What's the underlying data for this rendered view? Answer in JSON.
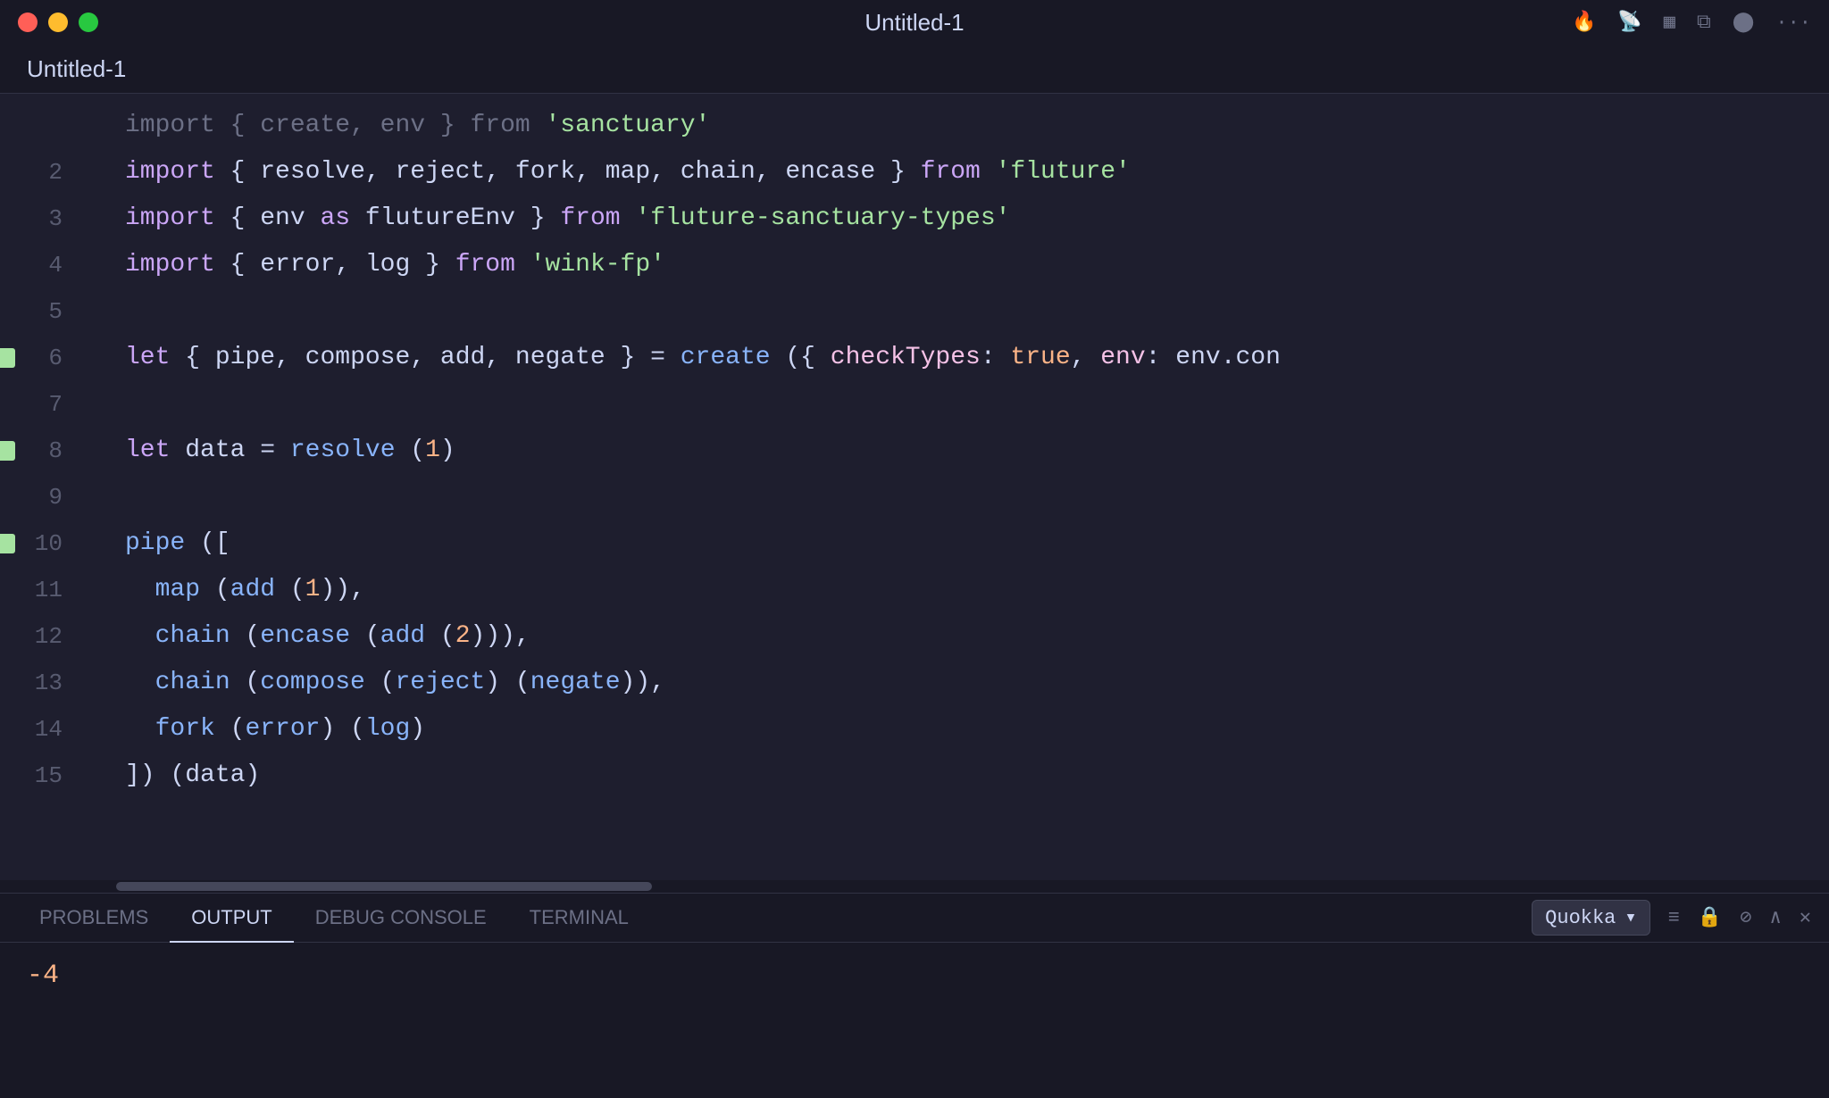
{
  "window": {
    "title": "Untitled-1"
  },
  "titlebar": {
    "title": "Untitled-1",
    "traffic_lights": [
      "red",
      "yellow",
      "green"
    ]
  },
  "editor": {
    "tab_name": "Untitled-1",
    "lines": [
      {
        "number": "",
        "dot": false,
        "content_raw": "import { create, env } from 'sanctuary'",
        "faded": true
      },
      {
        "number": "2",
        "dot": false,
        "content_raw": "import { resolve, reject, fork, map, chain, encase } from 'fluture'"
      },
      {
        "number": "3",
        "dot": false,
        "content_raw": "import { env as flutureEnv } from 'fluture-sanctuary-types'"
      },
      {
        "number": "4",
        "dot": false,
        "content_raw": "import { error, log } from 'wink-fp'"
      },
      {
        "number": "5",
        "dot": false,
        "content_raw": ""
      },
      {
        "number": "6",
        "dot": true,
        "content_raw": "let { pipe, compose, add, negate } = create ({ checkTypes: true, env: env.con"
      },
      {
        "number": "7",
        "dot": false,
        "content_raw": ""
      },
      {
        "number": "8",
        "dot": true,
        "content_raw": "let data = resolve (1)"
      },
      {
        "number": "9",
        "dot": false,
        "content_raw": ""
      },
      {
        "number": "10",
        "dot": true,
        "content_raw": "pipe (["
      },
      {
        "number": "11",
        "dot": false,
        "content_raw": "  map (add (1)),"
      },
      {
        "number": "12",
        "dot": false,
        "content_raw": "  chain (encase (add (2))),"
      },
      {
        "number": "13",
        "dot": false,
        "content_raw": "  chain (compose (reject) (negate)),"
      },
      {
        "number": "14",
        "dot": false,
        "content_raw": "  fork (error) (log)"
      },
      {
        "number": "15",
        "dot": false,
        "content_raw": "]) (data)"
      }
    ]
  },
  "panel": {
    "tabs": [
      {
        "label": "PROBLEMS",
        "active": false
      },
      {
        "label": "OUTPUT",
        "active": true
      },
      {
        "label": "DEBUG CONSOLE",
        "active": false
      },
      {
        "label": "TERMINAL",
        "active": false
      }
    ],
    "dropdown_label": "Quokka",
    "output_value": "-4"
  }
}
